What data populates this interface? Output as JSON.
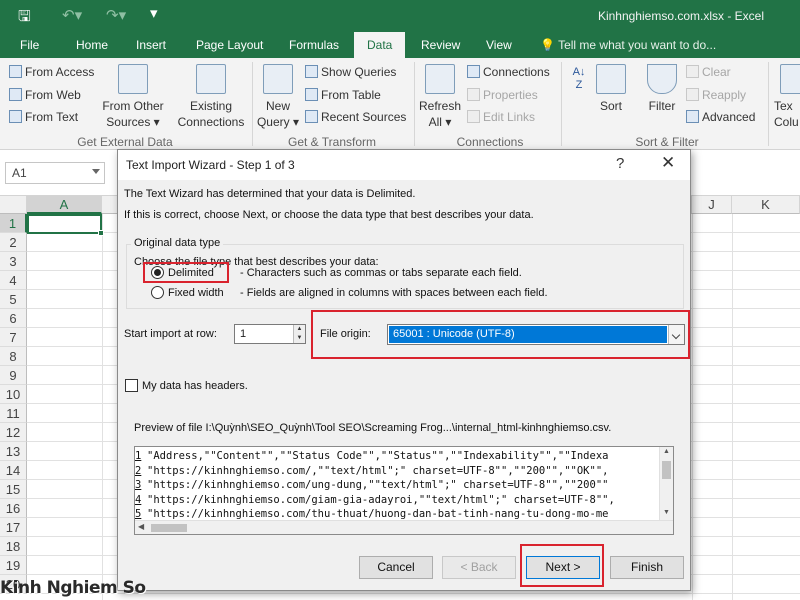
{
  "window": {
    "title": "Kinhnghiemso.com.xlsx - Excel",
    "qat_icons": [
      "save-icon",
      "undo-icon",
      "redo-icon",
      "customize-qat-icon"
    ]
  },
  "ribbon": {
    "tabs": [
      "File",
      "Home",
      "Insert",
      "Page Layout",
      "Formulas",
      "Data",
      "Review",
      "View"
    ],
    "active_tab": "Data",
    "tell_me": "Tell me what you want to do...",
    "get_external": {
      "from_access": "From Access",
      "from_web": "From Web",
      "from_text": "From Text",
      "from_other_1": "From Other",
      "from_other_2": "Sources",
      "existing_1": "Existing",
      "existing_2": "Connections",
      "label": "Get External Data"
    },
    "get_transform": {
      "new_query_1": "New",
      "new_query_2": "Query",
      "show_queries": "Show Queries",
      "from_table": "From Table",
      "recent_sources": "Recent Sources",
      "label": "Get & Transform"
    },
    "connections": {
      "refresh_1": "Refresh",
      "refresh_2": "All",
      "connections": "Connections",
      "properties": "Properties",
      "edit_links": "Edit Links",
      "label": "Connections"
    },
    "sort_filter": {
      "sort": "Sort",
      "filter": "Filter",
      "clear": "Clear",
      "reapply": "Reapply",
      "advanced": "Advanced",
      "label": "Sort & Filter"
    },
    "data_tools": {
      "text_to_1": "Tex",
      "text_to_2": "Colu"
    }
  },
  "formula_bar": {
    "name_box": "A1"
  },
  "grid": {
    "columns": [
      "A",
      "J",
      "K"
    ],
    "rows": [
      "1",
      "2",
      "3",
      "4",
      "5",
      "6",
      "7",
      "8",
      "9",
      "10",
      "11",
      "12",
      "13",
      "14",
      "15",
      "16",
      "17",
      "18",
      "19",
      "20"
    ]
  },
  "dialog": {
    "title": "Text Import Wizard - Step 1 of 3",
    "intro_1": "The Text Wizard has determined that your data is Delimited.",
    "intro_2": "If this is correct, choose Next, or choose the data type that best describes your data.",
    "group_label": "Original data type",
    "choose_label": "Choose the file type that best describes your data:",
    "delimited": "Delimited",
    "delimited_desc": "- Characters such as commas or tabs separate each field.",
    "fixed_width": "Fixed width",
    "fixed_width_desc": "- Fields are aligned in columns with spaces between each field.",
    "start_row_label": "Start import at row:",
    "start_row_value": "1",
    "file_origin_label": "File origin:",
    "file_origin_value": "65001 : Unicode (UTF-8)",
    "headers_label": "My data has headers.",
    "preview_label": "Preview of file I:\\Quỳnh\\SEO_Quỳnh\\Tool SEO\\Screaming Frog...\\internal_html-kinhnghiemso.csv.",
    "preview_rows": [
      {
        "num": "1",
        "text": "\"Address,\"\"Content\"\",\"\"Status Code\"\",\"\"Status\"\",\"\"Indexability\"\",\"\"Indexa"
      },
      {
        "num": "2",
        "text": "\"https://kinhnghiemso.com/,\"\"text/html\";\" charset=UTF-8\"\",\"\"200\"\",\"\"OK\"\","
      },
      {
        "num": "3",
        "text": "\"https://kinhnghiemso.com/ung-dung,\"\"text/html\";\" charset=UTF-8\"\",\"\"200\"\""
      },
      {
        "num": "4",
        "text": "\"https://kinhnghiemso.com/giam-gia-adayroi,\"\"text/html\";\" charset=UTF-8\"\","
      },
      {
        "num": "5",
        "text": "\"https://kinhnghiemso.com/thu-thuat/huong-dan-bat-tinh-nang-tu-dong-mo-me"
      }
    ],
    "buttons": {
      "cancel": "Cancel",
      "back": "< Back",
      "next": "Next >",
      "finish": "Finish"
    }
  },
  "watermark": "Kinh Nghiem So",
  "colors": {
    "excel_green": "#217346",
    "highlight_red": "#d9232e",
    "selection_blue": "#0078d7"
  }
}
